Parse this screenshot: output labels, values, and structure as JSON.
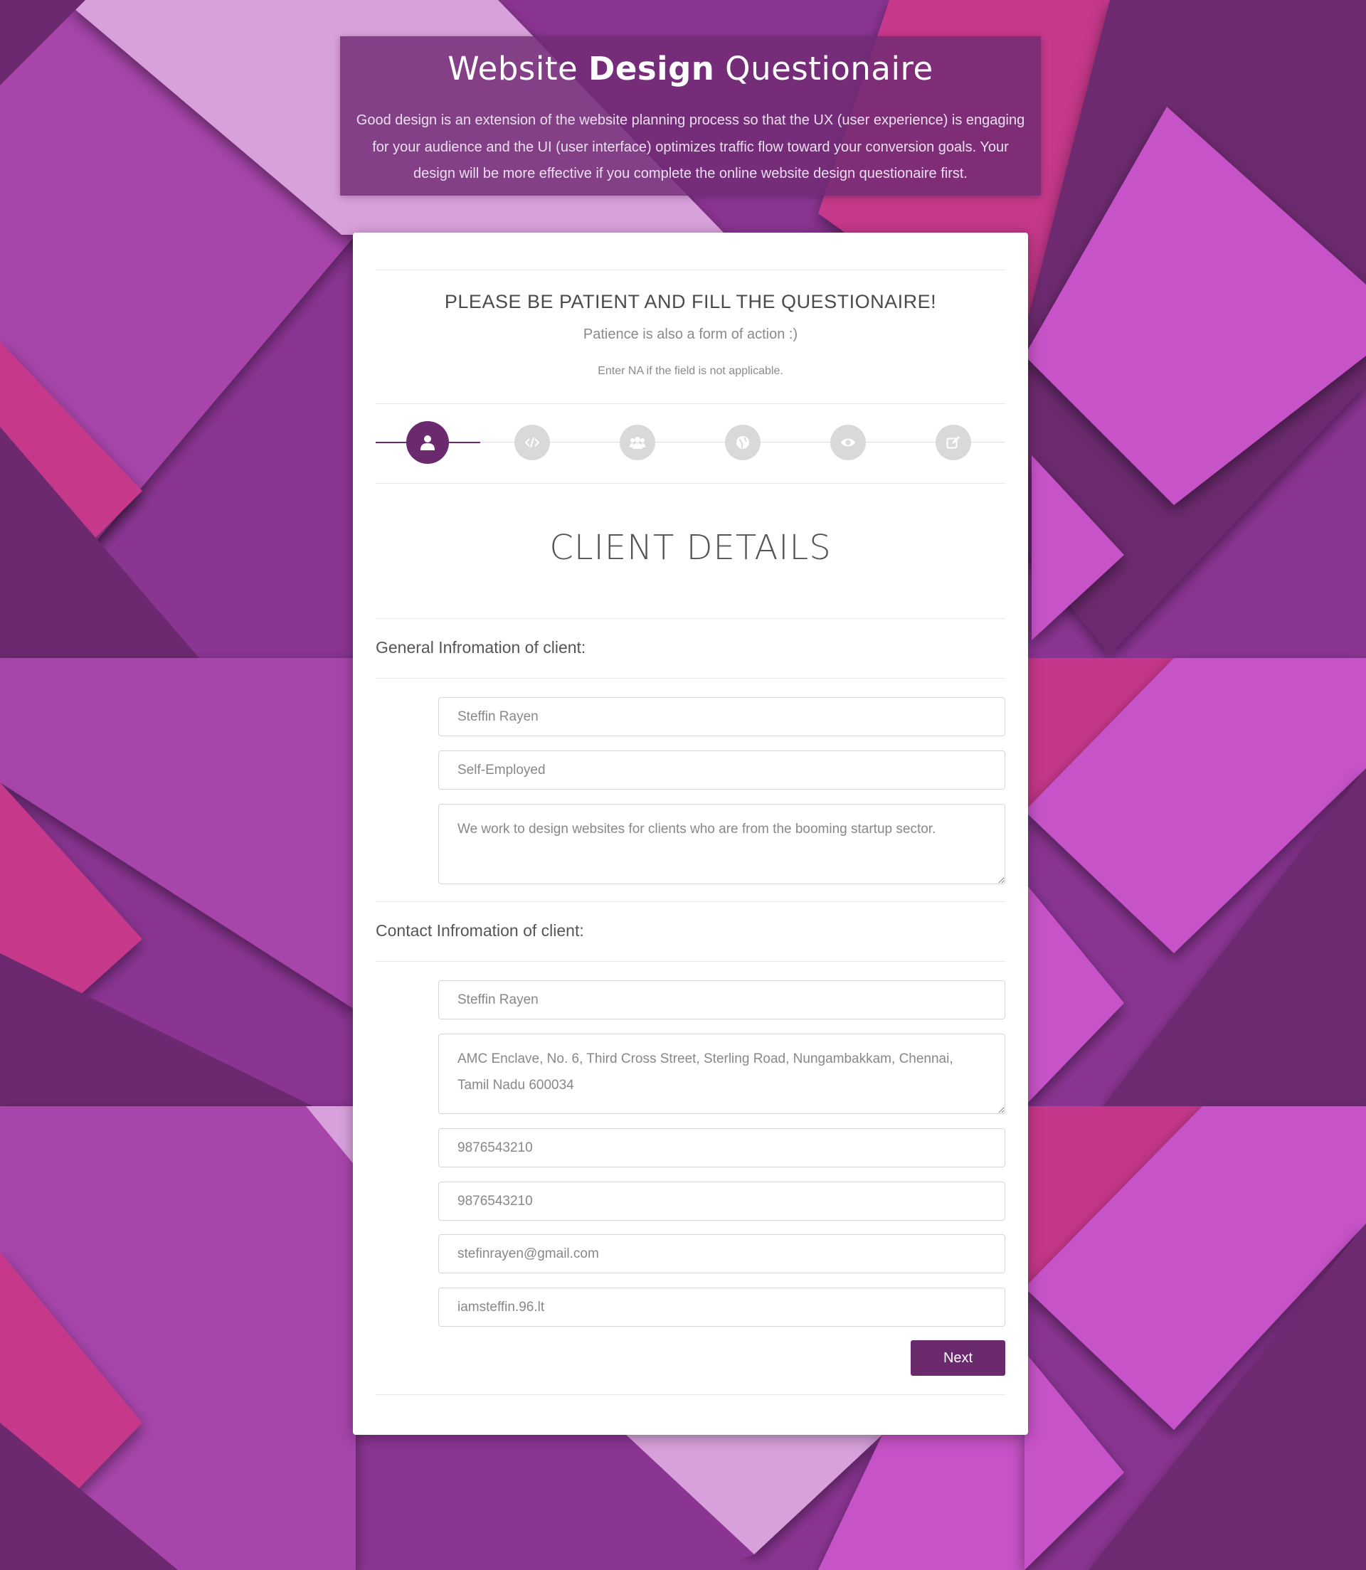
{
  "header": {
    "title_pre": "Website ",
    "title_bold": "Design",
    "title_post": " Questionaire",
    "description": "Good design is an extension of the website planning process so that the UX (user experience) is engaging for your audience and the UI (user interface) optimizes traffic flow toward your conversion goals. Your design will be more effective if you complete the online website design questionaire first."
  },
  "intro": {
    "heading": "PLEASE BE PATIENT AND FILL THE QUESTIONAIRE!",
    "subheading": "Patience is also a form of action :)",
    "note": "Enter NA if the field is not applicable."
  },
  "steps": [
    {
      "icon": "user-icon",
      "active": true
    },
    {
      "icon": "code-icon",
      "active": false
    },
    {
      "icon": "users-icon",
      "active": false
    },
    {
      "icon": "globe-icon",
      "active": false
    },
    {
      "icon": "eye-icon",
      "active": false
    },
    {
      "icon": "edit-icon",
      "active": false
    }
  ],
  "section_title": "CLIENT DETAILS",
  "general": {
    "label": "General Infromation of client:",
    "name": "Steffin Rayen",
    "occupation": "Self-Employed",
    "about": "We work to design websites for clients who are from the booming startup sector."
  },
  "contact": {
    "label": "Contact Infromation of client:",
    "name": "Steffin Rayen",
    "address": "AMC Enclave, No. 6, Third Cross Street, Sterling Road, Nungambakkam, Chennai, Tamil Nadu 600034",
    "phone1": "9876543210",
    "phone2": "9876543210",
    "email": "stefinrayen@gmail.com",
    "website": "iamsteffin.96.lt"
  },
  "buttons": {
    "next": "Next"
  },
  "colors": {
    "accent": "#6c2a6e",
    "header_bg": "#702b74",
    "step_inactive": "#d9d9d9"
  }
}
